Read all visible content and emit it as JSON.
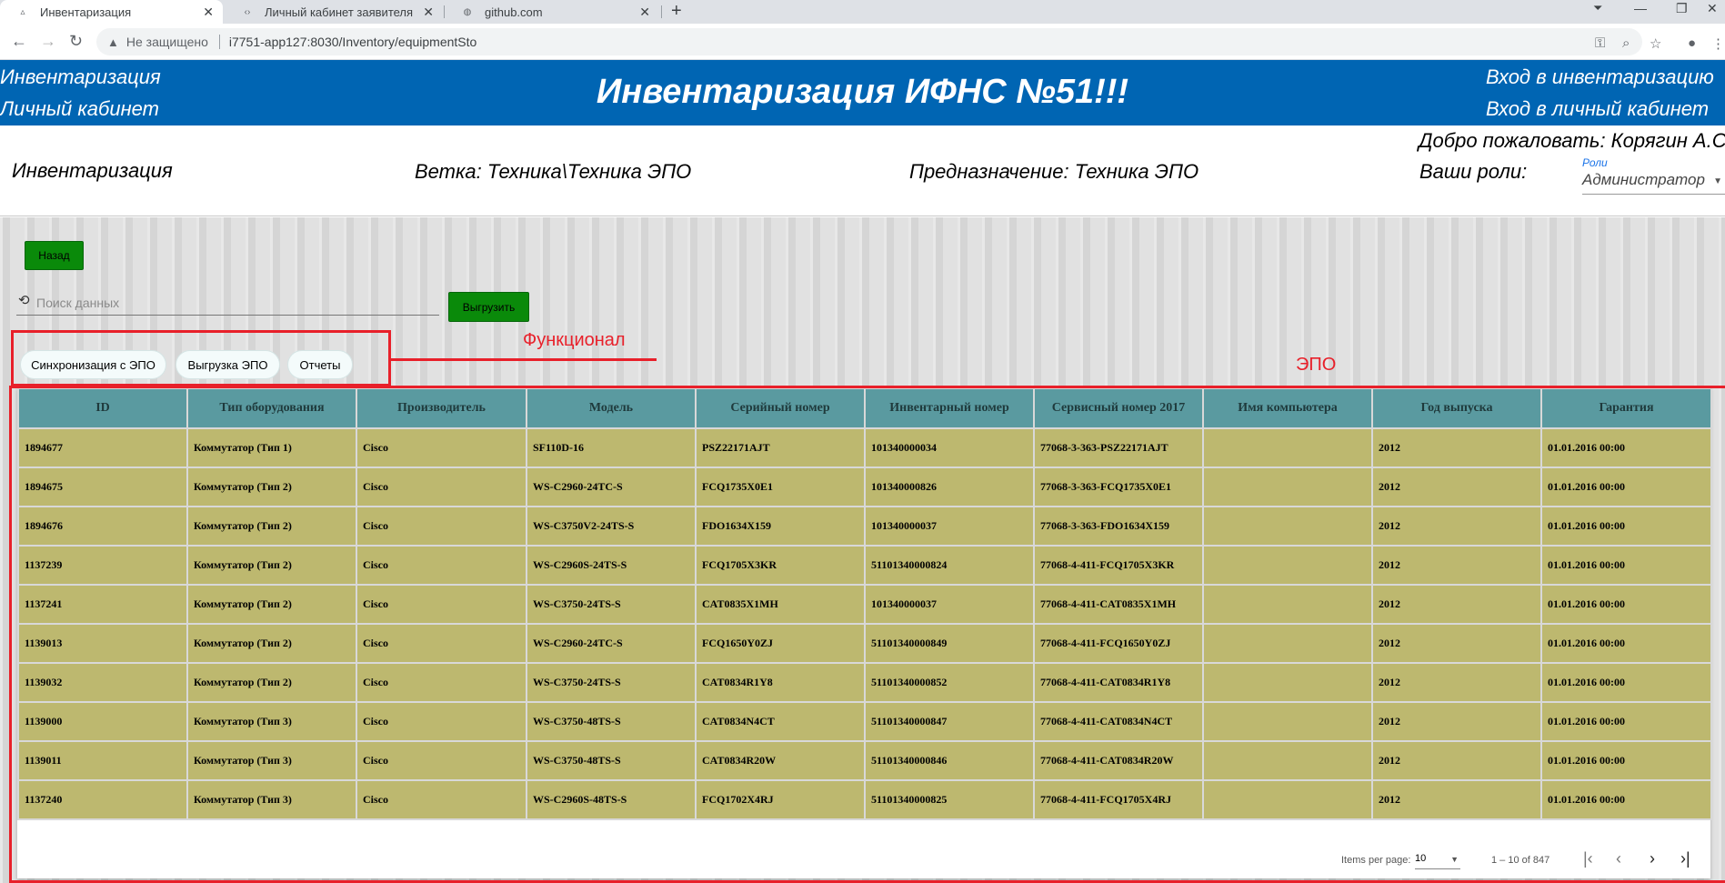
{
  "browser": {
    "tabs": [
      {
        "title": "Инвентаризация",
        "active": true
      },
      {
        "title": "Личный кабинет заявителя",
        "active": false
      },
      {
        "title": "github.com",
        "active": false
      }
    ],
    "security_label": "Не защищено",
    "url": "i7751-app127:8030/Inventory/equipmentSto"
  },
  "header": {
    "left_links": [
      "Инвентаризация",
      "Личный кабинет"
    ],
    "title": "Инвентаризация ИФНС №51!!!",
    "right_links": [
      "Вход в инвентаризацию",
      "Вход в личный кабинет"
    ]
  },
  "info": {
    "section": "Инвентаризация",
    "branch": "Ветка: Техника\\Техника ЭПО",
    "purpose": "Предназначение: Техника ЭПО",
    "welcome": "Добро пожаловать: Корягин А.С",
    "roles_prefix": "Ваши роли:",
    "roles_label": "Роли",
    "role_selected": "Администратор"
  },
  "toolbar": {
    "back_label": "Назад",
    "search_placeholder": "Поиск данных",
    "export_label": "Выгрузить"
  },
  "actions": [
    "Синхронизация с ЭПО",
    "Выгрузка ЭПО",
    "Отчеты"
  ],
  "annotations": {
    "functional": "Функционал",
    "epo": "ЭПО",
    "color": "#e8202a"
  },
  "table": {
    "columns": [
      "ID",
      "Тип оборудования",
      "Производитель",
      "Модель",
      "Серийный номер",
      "Инвентарный номер",
      "Сервисный номер 2017",
      "Имя компьютера",
      "Год выпуска",
      "Гарантия"
    ],
    "rows": [
      [
        "1894677",
        "Коммутатор (Тип 1)",
        "Cisco",
        "SF110D-16",
        "PSZ22171AJT",
        "101340000034",
        "77068-3-363-PSZ22171AJT",
        "",
        "2012",
        "01.01.2016 00:00"
      ],
      [
        "1894675",
        "Коммутатор (Тип 2)",
        "Cisco",
        "WS-C2960-24TC-S",
        "FCQ1735X0E1",
        "101340000826",
        "77068-3-363-FCQ1735X0E1",
        "",
        "2012",
        "01.01.2016 00:00"
      ],
      [
        "1894676",
        "Коммутатор (Тип 2)",
        "Cisco",
        "WS-C3750V2-24TS-S",
        "FDO1634X159",
        "101340000037",
        "77068-3-363-FDO1634X159",
        "",
        "2012",
        "01.01.2016 00:00"
      ],
      [
        "1137239",
        "Коммутатор (Тип 2)",
        "Cisco",
        "WS-C2960S-24TS-S",
        "FCQ1705X3KR",
        "51101340000824",
        "77068-4-411-FCQ1705X3KR",
        "",
        "2012",
        "01.01.2016 00:00"
      ],
      [
        "1137241",
        "Коммутатор (Тип 2)",
        "Cisco",
        "WS-C3750-24TS-S",
        "CAT0835X1MH",
        "101340000037",
        "77068-4-411-CAT0835X1MH",
        "",
        "2012",
        "01.01.2016 00:00"
      ],
      [
        "1139013",
        "Коммутатор (Тип 2)",
        "Cisco",
        "WS-C2960-24TC-S",
        "FCQ1650Y0ZJ",
        "51101340000849",
        "77068-4-411-FCQ1650Y0ZJ",
        "",
        "2012",
        "01.01.2016 00:00"
      ],
      [
        "1139032",
        "Коммутатор (Тип 2)",
        "Cisco",
        "WS-C3750-24TS-S",
        "CAT0834R1Y8",
        "51101340000852",
        "77068-4-411-CAT0834R1Y8",
        "",
        "2012",
        "01.01.2016 00:00"
      ],
      [
        "1139000",
        "Коммутатор (Тип 3)",
        "Cisco",
        "WS-C3750-48TS-S",
        "CAT0834N4CT",
        "51101340000847",
        "77068-4-411-CAT0834N4CT",
        "",
        "2012",
        "01.01.2016 00:00"
      ],
      [
        "1139011",
        "Коммутатор (Тип 3)",
        "Cisco",
        "WS-C3750-48TS-S",
        "CAT0834R20W",
        "51101340000846",
        "77068-4-411-CAT0834R20W",
        "",
        "2012",
        "01.01.2016 00:00"
      ],
      [
        "1137240",
        "Коммутатор (Тип 3)",
        "Cisco",
        "WS-C2960S-48TS-S",
        "FCQ1702X4RJ",
        "51101340000825",
        "77068-4-411-FCQ1705X4RJ",
        "",
        "2012",
        "01.01.2016 00:00"
      ]
    ]
  },
  "paginator": {
    "items_per_page_label": "Items per page:",
    "page_size": "10",
    "range": "1 – 10 of 847"
  },
  "colors": {
    "header_blue": "#0065b3",
    "button_green": "#0a8a0a",
    "table_header": "#5a9aa0",
    "table_cell": "#bdb86f"
  }
}
